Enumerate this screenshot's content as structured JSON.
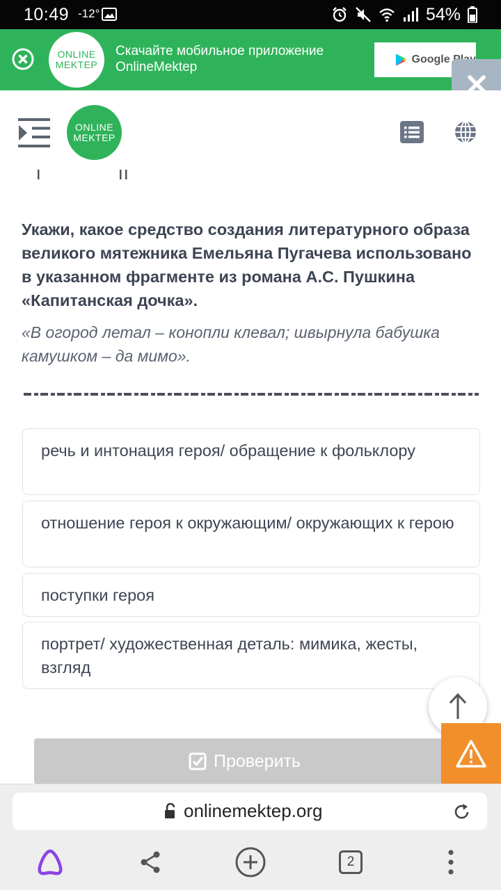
{
  "status_bar": {
    "time": "10:49",
    "temperature": "-12°",
    "battery": "54%"
  },
  "promo": {
    "logo_line1": "ONLINE",
    "logo_line2": "MEKTEP",
    "line1": "Скачайте мобильное приложение",
    "line2": "OnlineMektep",
    "store_label": "Google Play"
  },
  "header": {
    "logo_line1": "ONLINE",
    "logo_line2": "MEKTEP"
  },
  "question": {
    "text": "Укажи, какое средство создания литературного образа великого мятежника Емельяна Пугачева использовано в указанном фрагменте из романа А.С. Пушкина «Капитанская дочка».",
    "quote": "«В огород летал – конопли клевал; швырнула бабушка камушком – да мимо»."
  },
  "options": [
    {
      "label": "речь и интонация героя/ обращение к фольклору"
    },
    {
      "label": "отношение героя к окружающим/ окружающих к герою"
    },
    {
      "label": "поступки героя"
    },
    {
      "label": "портрет/ художественная деталь: мимика, жесты, взгляд"
    }
  ],
  "check_button": {
    "label": "Проверить"
  },
  "browser": {
    "url": "onlinemektep.org",
    "tab_count": "2"
  },
  "colors": {
    "brand_green": "#2fb35a",
    "report_orange": "#f28f2a",
    "alice_purple": "#8a44e6"
  }
}
